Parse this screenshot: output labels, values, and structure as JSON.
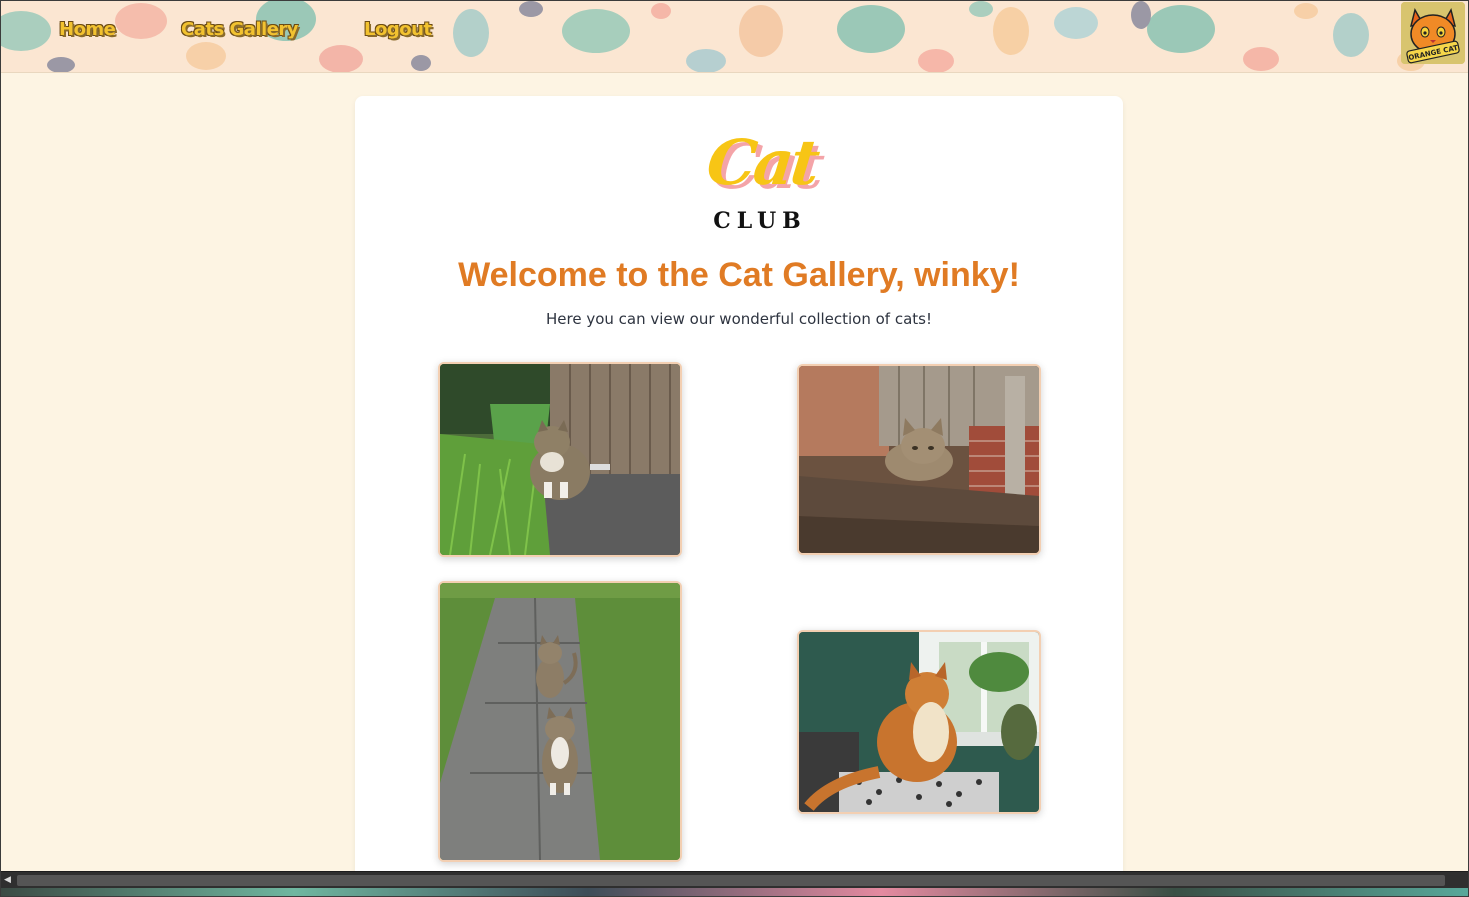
{
  "nav": {
    "home": "Home",
    "gallery": "Cats Gallery",
    "logout": "Logout"
  },
  "badge": {
    "text": "ORANGE CAT"
  },
  "logo": {
    "cat": "Cat",
    "club": "CLUB"
  },
  "main": {
    "title": "Welcome to the Cat Gallery, winky!",
    "subtitle": "Here you can view our wonderful collection of cats!"
  },
  "colors": {
    "accent": "#e07b24",
    "nav_text": "#f2c230",
    "page_bg": "#fdf4e3",
    "photo_border": "#f3cfb2"
  },
  "gallery": [
    {
      "name": "cat-photo-1"
    },
    {
      "name": "cat-photo-2"
    },
    {
      "name": "cat-photo-3"
    },
    {
      "name": "cat-photo-4"
    }
  ]
}
